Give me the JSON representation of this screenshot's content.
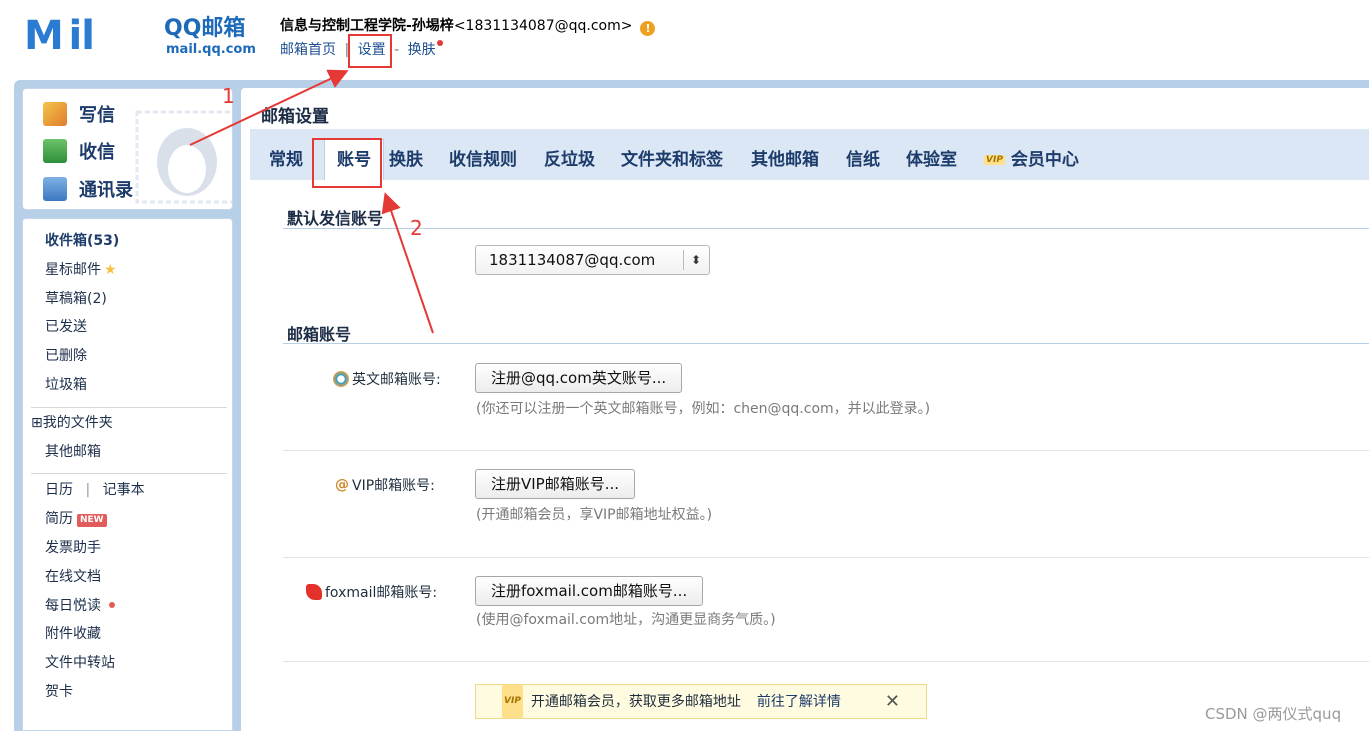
{
  "header": {
    "logo_mail": "M il",
    "logo_brand": "QQ邮箱",
    "logo_domain": "mail.qq.com",
    "account_name": "信息与控制工程学院-孙埸梓",
    "account_email": "<1831134087@qq.com>",
    "warn_symbol": "!",
    "links": {
      "home": "邮箱首页",
      "sep1": "|",
      "settings": "设置",
      "sep2": "-",
      "skin": "换肤"
    }
  },
  "sidebar": {
    "compose": "写信",
    "inbox_top": "收信",
    "contacts": "通讯录",
    "folders": {
      "inbox": "收件箱(53)",
      "starred": "星标邮件",
      "star_glyph": "★",
      "drafts": "草稿箱(2)",
      "sent": "已发送",
      "deleted": "已删除",
      "spam": "垃圾箱",
      "my_folders": "⊞我的文件夹",
      "other_mailboxes": "其他邮箱",
      "calendar": "日历",
      "cal_sep": "|",
      "notes": "记事本",
      "resume": "简历",
      "new_badge": "NEW",
      "invoice": "发票助手",
      "docs": "在线文档",
      "daily": "每日悦读",
      "attachments": "附件收藏",
      "transfer": "文件中转站",
      "cards": "贺卡"
    }
  },
  "panel": {
    "title": "邮箱设置",
    "tabs": [
      "常规",
      "账号",
      "换肤",
      "收信规则",
      "反垃圾",
      "文件夹和标签",
      "其他邮箱",
      "信纸",
      "体验室",
      "会员中心"
    ],
    "vip_badge": "VIP",
    "active_tab": "账号",
    "default_section": "默认发信账号",
    "default_account": "1831134087@qq.com",
    "select_arrow": "⬍",
    "mail_accounts_section": "邮箱账号",
    "rows": [
      {
        "label": "英文邮箱账号:",
        "button": "注册@qq.com英文账号...",
        "hint": "(你还可以注册一个英文邮箱账号，例如：chen@qq.com，并以此登录。)"
      },
      {
        "label": "VIP邮箱账号:",
        "icon_glyph": "@",
        "button": "注册VIP邮箱账号...",
        "hint": "(开通邮箱会员，享VIP邮箱地址权益。)"
      },
      {
        "label": "foxmail邮箱账号:",
        "button": "注册foxmail.com邮箱账号...",
        "hint": "(使用@foxmail.com地址，沟通更显商务气质。)"
      }
    ],
    "promo": {
      "text": "开通邮箱会员，获取更多邮箱地址",
      "link": "前往了解详情",
      "close": "✕"
    }
  },
  "annotations": {
    "step1": "1",
    "step2": "2",
    "color": "#e53935"
  },
  "watermark": "CSDN @两仪式quq",
  "colors": {
    "frame_blue": "#b8cfe8",
    "tab_bar": "#dbe7f4",
    "nav_text": "#1d3c6b",
    "brand_blue": "#2a7bd1"
  }
}
